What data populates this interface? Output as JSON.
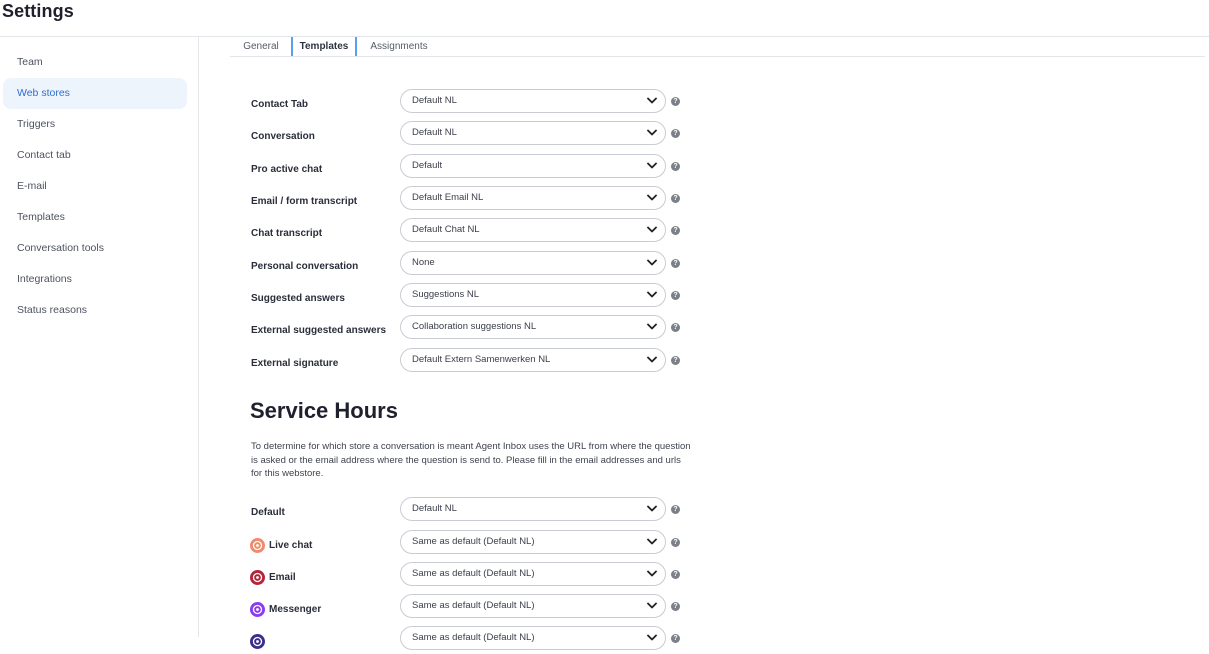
{
  "page": {
    "title": "Settings"
  },
  "sidebar": {
    "items": [
      {
        "label": "Team"
      },
      {
        "label": "Web stores",
        "active": true
      },
      {
        "label": "Triggers"
      },
      {
        "label": "Contact tab"
      },
      {
        "label": "E-mail"
      },
      {
        "label": "Templates"
      },
      {
        "label": "Conversation tools"
      },
      {
        "label": "Integrations"
      },
      {
        "label": "Status reasons"
      }
    ]
  },
  "tabs": [
    {
      "label": "General"
    },
    {
      "label": "Templates",
      "active": true
    },
    {
      "label": "Assignments"
    }
  ],
  "templates": [
    {
      "label": "Contact Tab",
      "value": "Default NL"
    },
    {
      "label": "Conversation",
      "value": "Default NL"
    },
    {
      "label": "Pro active chat",
      "value": "Default"
    },
    {
      "label": "Email / form transcript",
      "value": "Default Email NL"
    },
    {
      "label": "Chat transcript",
      "value": "Default Chat NL"
    },
    {
      "label": "Personal conversation",
      "value": "None"
    },
    {
      "label": "Suggested answers",
      "value": "Suggestions NL"
    },
    {
      "label": "External suggested answers",
      "value": "Collaboration suggestions NL"
    },
    {
      "label": "External signature",
      "value": "Default Extern Samenwerken NL"
    }
  ],
  "service_hours": {
    "title": "Service Hours",
    "description": "To determine for which store a conversation is meant Agent Inbox uses the URL from where the question is asked or the email address where the question is send to. Please fill in the email addresses and urls for this webstore.",
    "rows": [
      {
        "label": "Default",
        "value": "Default NL"
      },
      {
        "label": "Live chat",
        "value": "Same as default (Default NL)",
        "icon": "live-chat-icon",
        "color": "#f08a6c"
      },
      {
        "label": "Email",
        "value": "Same as default (Default NL)",
        "icon": "email-icon",
        "color": "#b3263a"
      },
      {
        "label": "Messenger",
        "value": "Same as default (Default NL)",
        "icon": "messenger-icon",
        "color": "#8a3cf0"
      },
      {
        "label": "",
        "value": "Same as default (Default NL)",
        "icon": "channel-icon",
        "color": "#3b2f8c"
      }
    ]
  },
  "help_glyph": "?"
}
